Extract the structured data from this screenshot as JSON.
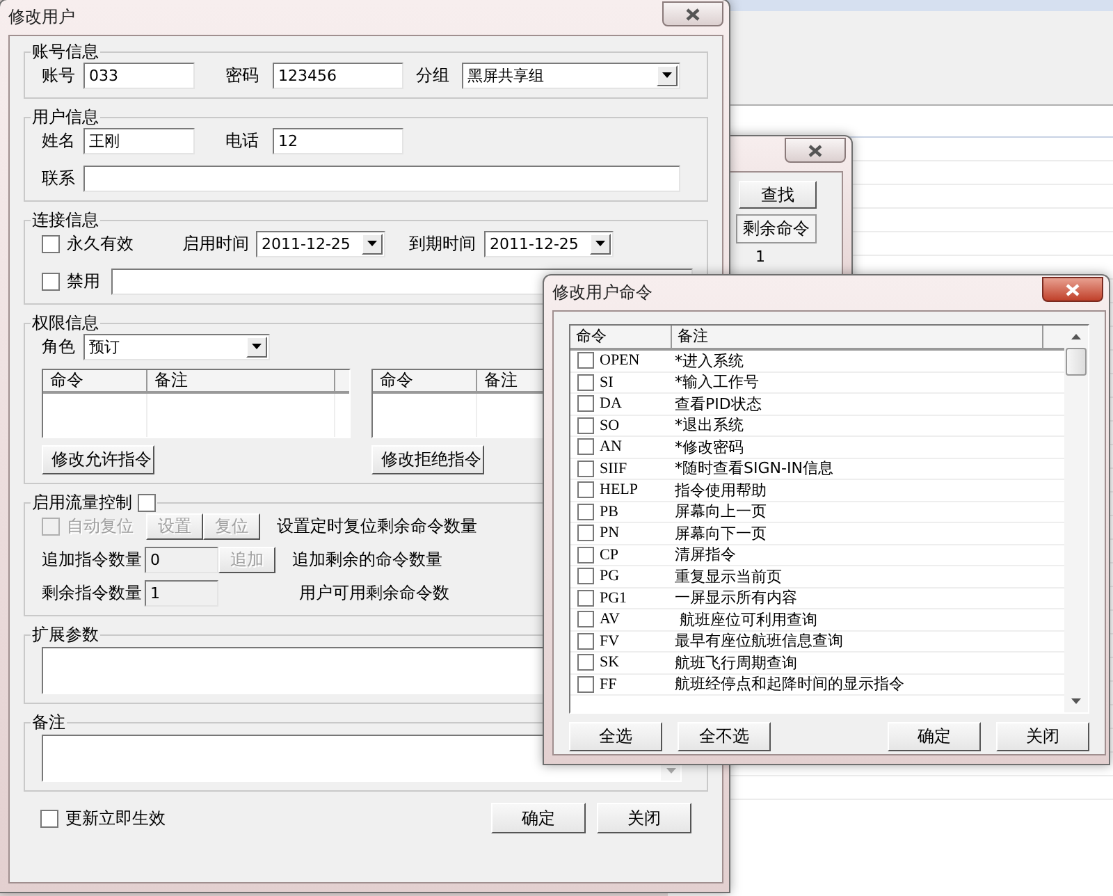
{
  "background_window": {
    "find_button": "查找",
    "table": {
      "columns": [
        "剩余命令"
      ],
      "rows": [
        [
          "1"
        ]
      ]
    }
  },
  "edit_user_dialog": {
    "title": "修改用户",
    "account": {
      "legend": "账号信息",
      "account": {
        "label": "账号",
        "value": "033"
      },
      "password": {
        "label": "密码",
        "value": "123456"
      },
      "group": {
        "label": "分组",
        "value": "黑屏共享组"
      }
    },
    "user": {
      "legend": "用户信息",
      "name": {
        "label": "姓名",
        "value": "王刚"
      },
      "phone": {
        "label": "电话",
        "value": "12"
      },
      "contact": {
        "label": "联系"
      }
    },
    "connection": {
      "legend": "连接信息",
      "permanent": {
        "label": "永久有效",
        "checked": false
      },
      "start": {
        "label": "启用时间",
        "value": "2011-12-25"
      },
      "expiry": {
        "label": "到期时间",
        "value": "2011-12-25"
      },
      "disable": {
        "label": "禁用",
        "checked": false
      }
    },
    "permissions": {
      "legend": "权限信息",
      "role": {
        "label": "角色",
        "value": "预订"
      },
      "allow_table": {
        "columns": [
          "命令",
          "备注"
        ]
      },
      "allow_button": "修改允许指令",
      "deny_table": {
        "columns": [
          "命令",
          "备注"
        ]
      },
      "deny_button": "修改拒绝指令"
    },
    "flow_control": {
      "legend": "启用流量控制",
      "checked": false,
      "auto_reset": {
        "label": "自动复位",
        "checked": false,
        "disabled": true
      },
      "set_button": {
        "label": "设置",
        "disabled": true
      },
      "reset_button": {
        "label": "复位",
        "disabled": true
      },
      "reset_note": "设置定时复位剩余命令数量",
      "add_count": {
        "label": "追加指令数量",
        "value": "0"
      },
      "add_button": {
        "label": "追加",
        "disabled": true
      },
      "add_note": "追加剩余的命令数量",
      "remaining": {
        "label": "剩余指令数量",
        "value": "1"
      },
      "remaining_note": "用户可用剩余命令数"
    },
    "extension": {
      "legend": "扩展参数"
    },
    "remark": {
      "legend": "备注"
    },
    "apply_now": {
      "label": "更新立即生效",
      "checked": false
    },
    "buttons": [
      "确定",
      "关闭"
    ]
  },
  "command_dialog": {
    "title": "修改用户命令",
    "columns": [
      "命令",
      "备注"
    ],
    "rows": [
      {
        "command": "OPEN",
        "note": "*进入系统",
        "checked": false
      },
      {
        "command": "SI",
        "note": "*输入工作号",
        "checked": false
      },
      {
        "command": "DA",
        "note": "查看PID状态",
        "checked": false
      },
      {
        "command": "SO",
        "note": "*退出系统",
        "checked": false
      },
      {
        "command": "AN",
        "note": "*修改密码",
        "checked": false
      },
      {
        "command": "SIIF",
        "note": "*随时查看SIGN-IN信息",
        "checked": false
      },
      {
        "command": "HELP",
        "note": "指令使用帮助",
        "checked": false
      },
      {
        "command": "PB",
        "note": "屏幕向上一页",
        "checked": false
      },
      {
        "command": "PN",
        "note": "屏幕向下一页",
        "checked": false
      },
      {
        "command": "CP",
        "note": "清屏指令",
        "checked": false
      },
      {
        "command": "PG",
        "note": "重复显示当前页",
        "checked": false
      },
      {
        "command": "PG1",
        "note": "一屏显示所有内容",
        "checked": false
      },
      {
        "command": "AV",
        "note": " 航班座位可利用查询",
        "checked": false
      },
      {
        "command": "FV",
        "note": "最早有座位航班信息查询",
        "checked": false
      },
      {
        "command": "SK",
        "note": "航班飞行周期查询",
        "checked": false
      },
      {
        "command": "FF",
        "note": "航班经停点和起降时间的显示指令",
        "checked": false
      }
    ],
    "buttons": [
      "全选",
      "全不选",
      "确定",
      "关闭"
    ]
  }
}
